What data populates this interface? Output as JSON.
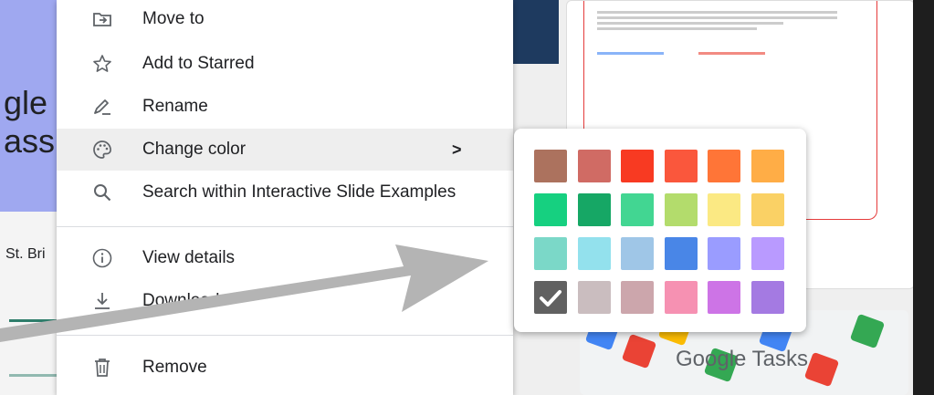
{
  "background": {
    "left_fragments": [
      "gle",
      "ass:",
      "St. Bri"
    ],
    "tasks_label": "Google Tasks"
  },
  "menu": {
    "items": [
      {
        "label": "Move to",
        "icon": "move-to-icon"
      },
      {
        "label": "Add to Starred",
        "icon": "star-icon"
      },
      {
        "label": "Rename",
        "icon": "rename-pencil-icon"
      },
      {
        "label": "Change color",
        "icon": "palette-icon",
        "submenu_indicator": ">",
        "highlighted": true
      },
      {
        "label": "Search within Interactive Slide Examples",
        "icon": "search-icon"
      },
      {
        "label": "View details",
        "icon": "info-icon"
      },
      {
        "label": "Download",
        "icon": "download-icon"
      },
      {
        "label": "Remove",
        "icon": "trash-icon"
      }
    ]
  },
  "palette": {
    "colors": [
      [
        "#ac725e",
        "#d06b64",
        "#f83a22",
        "#fa573c",
        "#ff7537",
        "#ffad46"
      ],
      [
        "#16d080",
        "#16a765",
        "#42d692",
        "#b3dc6c",
        "#fbe983",
        "#fad165"
      ],
      [
        "#7bd8c8",
        "#93e1ed",
        "#9fc6e7",
        "#4986e7",
        "#9a9cff",
        "#b99aff"
      ],
      [
        "#616161",
        "#cabdbf",
        "#cca6ac",
        "#f691b2",
        "#cd74e6",
        "#a47ae2"
      ]
    ],
    "selected": "#616161"
  },
  "annotation": {
    "arrow_color": "#b4b4b4"
  }
}
